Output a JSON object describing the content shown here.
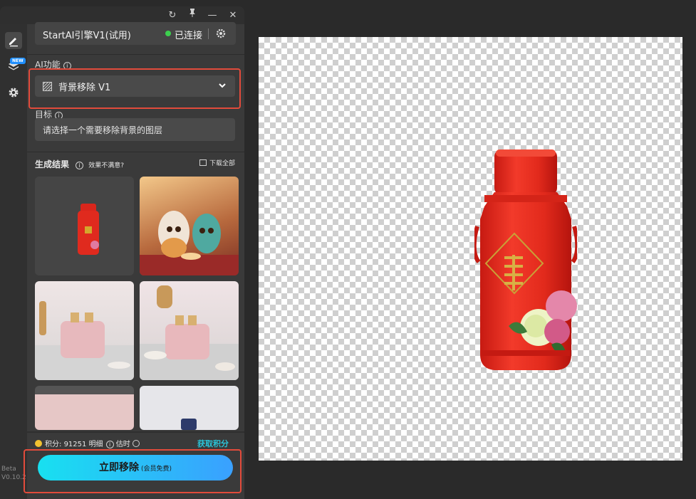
{
  "window": {
    "controls": {
      "refresh": "↻",
      "pin": "📌",
      "minimize": "—",
      "close": "✕"
    }
  },
  "rail": {
    "new_badge": "NEW",
    "beta": "Beta",
    "version": "V0.10.2"
  },
  "engine": {
    "name": "StartAI引擎V1(试用)",
    "status": "已连接",
    "status_color": "#3ccf4e"
  },
  "ai_function": {
    "label": "AI功能",
    "info": "i",
    "selected": "背景移除 V1"
  },
  "target": {
    "label": "目标",
    "info": "i",
    "placeholder": "请选择一个需要移除背景的图层"
  },
  "results": {
    "label": "生成结果",
    "unsatisfied": "效果不满意?",
    "download_all": "下载全部"
  },
  "footer": {
    "points_label": "积分:",
    "points_value": "91251",
    "detail": "明细",
    "estimate": "估时",
    "get_points": "获取积分"
  },
  "action": {
    "label": "立即移除",
    "sub": "(会员免费)"
  },
  "colors": {
    "accent_start": "#18e0f0",
    "accent_end": "#3aa0ff",
    "highlight": "#e24b3b",
    "link": "#2ac4d8"
  }
}
